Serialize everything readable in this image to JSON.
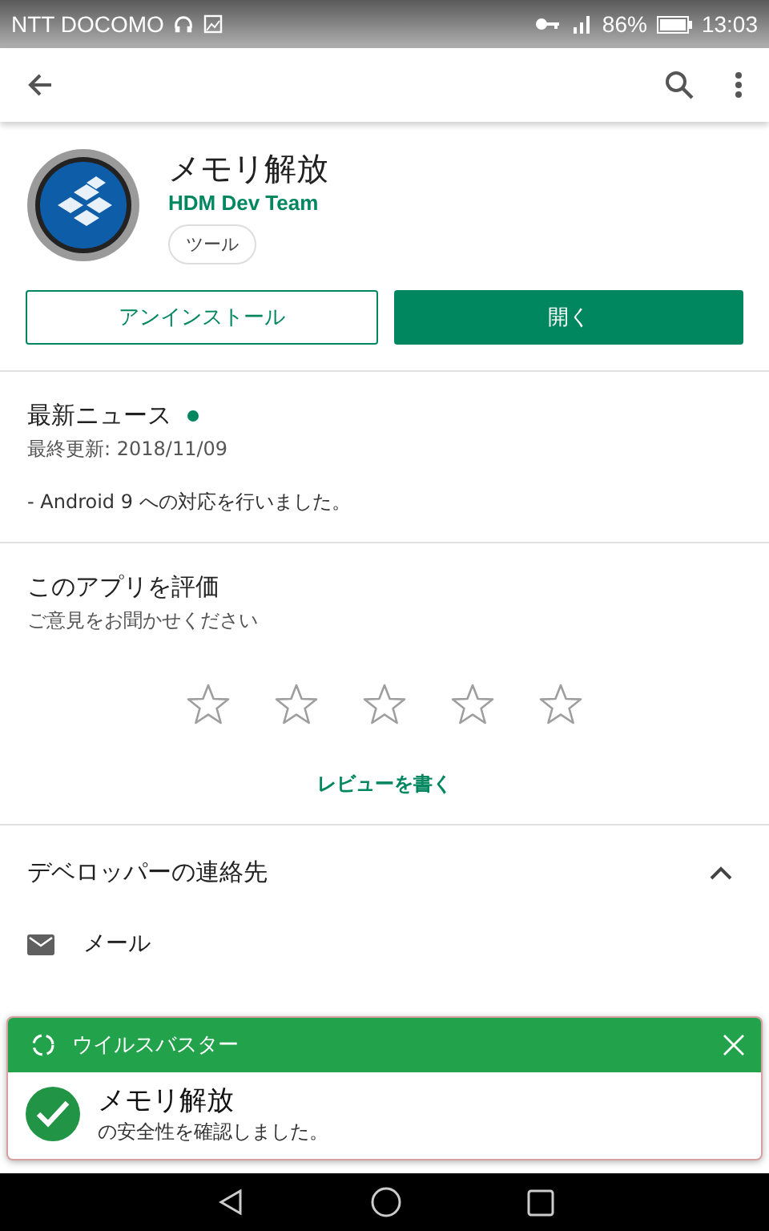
{
  "status_bar": {
    "carrier": "NTT DOCOMO",
    "battery": "86%",
    "time": "13:03"
  },
  "app": {
    "name": "メモリ解放",
    "developer": "HDM Dev Team",
    "category": "ツール"
  },
  "buttons": [
    {
      "label": "アンインストール",
      "kind": "outline"
    },
    {
      "label": "開く",
      "kind": "filled"
    }
  ],
  "news": {
    "title": "最新ニュース",
    "updated": "最終更新: 2018/11/09",
    "body": "- Android 9 への対応を行いました。"
  },
  "rating": {
    "title": "このアプリを評価",
    "subtitle": "ご意見をお聞かせください",
    "stars": 0,
    "review_link": "レビューを書く"
  },
  "developer_section": {
    "title": "デベロッパーの連絡先",
    "expanded": true,
    "items": [
      {
        "label": "メール"
      }
    ]
  },
  "notification": {
    "app": "ウイルスバスター",
    "title": "メモリ解放",
    "message": "の安全性を確認しました。"
  }
}
